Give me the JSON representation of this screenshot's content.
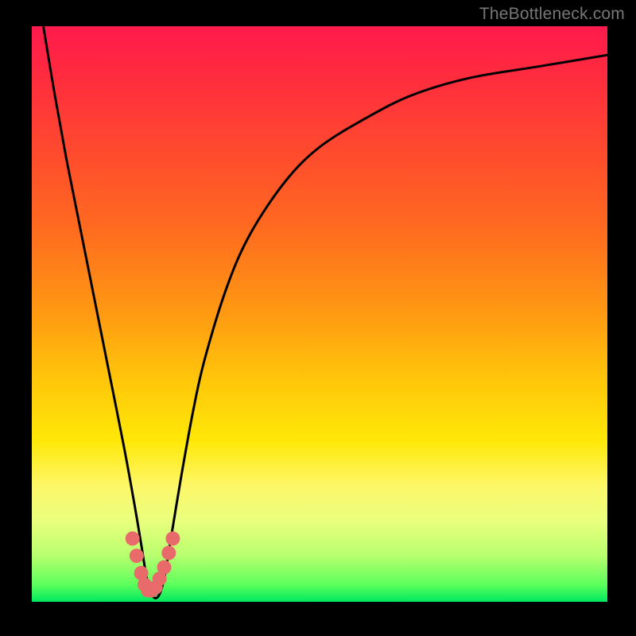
{
  "watermark": "TheBottleneck.com",
  "chart_data": {
    "type": "line",
    "title": "",
    "xlabel": "",
    "ylabel": "",
    "xlim": [
      0,
      100
    ],
    "ylim": [
      0,
      100
    ],
    "background_gradient": {
      "orientation": "vertical",
      "stops": [
        {
          "pos": 0,
          "color": "#ff1a4d"
        },
        {
          "pos": 50,
          "color": "#ff9a12"
        },
        {
          "pos": 75,
          "color": "#fff000"
        },
        {
          "pos": 100,
          "color": "#00e85e"
        }
      ]
    },
    "series": [
      {
        "name": "bottleneck-curve",
        "color": "#000000",
        "x": [
          2,
          4,
          6,
          8,
          10,
          12,
          14,
          16,
          18,
          19,
          20,
          21,
          22,
          23,
          24,
          26,
          28,
          30,
          34,
          38,
          44,
          50,
          58,
          66,
          76,
          88,
          100
        ],
        "y": [
          100,
          88,
          77,
          67,
          57,
          47,
          37,
          27,
          16,
          10,
          4,
          1,
          1,
          4,
          10,
          22,
          33,
          42,
          55,
          64,
          73,
          79,
          84,
          88,
          91,
          93,
          95
        ]
      },
      {
        "name": "bottleneck-markers",
        "color": "#e86a6a",
        "style": "markers",
        "x": [
          17.5,
          18.2,
          19.0,
          19.6,
          20.2,
          20.8,
          21.5,
          22.2,
          23.0,
          23.8,
          24.5
        ],
        "y": [
          11,
          8,
          5,
          3,
          2,
          2,
          2.5,
          4,
          6,
          8.5,
          11
        ]
      }
    ],
    "notch_x": 21,
    "notch_y": 1
  }
}
